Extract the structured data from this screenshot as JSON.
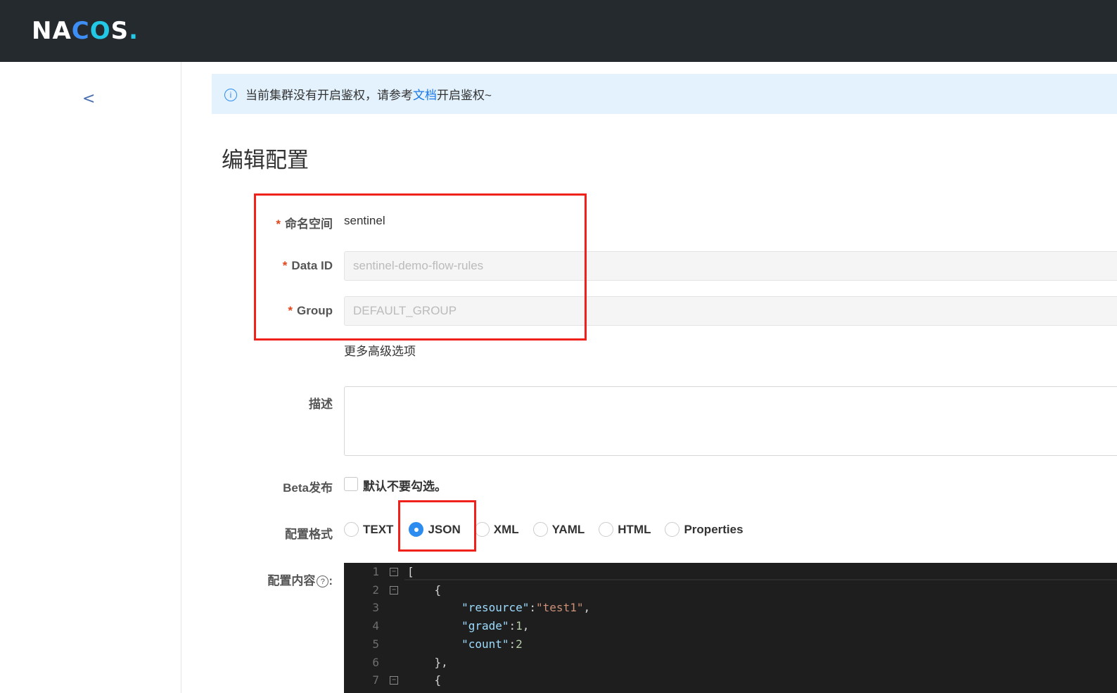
{
  "header": {
    "logo": "NACOS."
  },
  "notice": {
    "text_before": "当前集群没有开启鉴权，请参考",
    "link": "文档",
    "text_after": "开启鉴权~"
  },
  "page_title": "编辑配置",
  "form": {
    "namespace_label": "命名空间",
    "namespace_value": "sentinel",
    "dataid_label": "Data ID",
    "dataid_value": "sentinel-demo-flow-rules",
    "group_label": "Group",
    "group_value": "DEFAULT_GROUP",
    "advanced_link": "更多高级选项",
    "desc_label": "描述",
    "beta_label": "Beta发布",
    "beta_text": "默认不要勾选。",
    "format_label": "配置格式",
    "formats": [
      "TEXT",
      "JSON",
      "XML",
      "YAML",
      "HTML",
      "Properties"
    ],
    "selected_format": "JSON",
    "content_label": "配置内容",
    "help_glyph": "?",
    "colon": ":"
  },
  "editor": {
    "lines": [
      {
        "n": "1",
        "tokens": [
          [
            "p",
            "["
          ]
        ]
      },
      {
        "n": "2",
        "tokens": [
          [
            "p",
            "    {"
          ]
        ]
      },
      {
        "n": "3",
        "tokens": [
          [
            "p",
            "        "
          ],
          [
            "k",
            "\"resource\""
          ],
          [
            "p",
            ":"
          ],
          [
            "s",
            "\"test1\""
          ],
          [
            "p",
            ","
          ]
        ]
      },
      {
        "n": "4",
        "tokens": [
          [
            "p",
            "        "
          ],
          [
            "k",
            "\"grade\""
          ],
          [
            "p",
            ":"
          ],
          [
            "n",
            "1"
          ],
          [
            "p",
            ","
          ]
        ]
      },
      {
        "n": "5",
        "tokens": [
          [
            "p",
            "        "
          ],
          [
            "k",
            "\"count\""
          ],
          [
            "p",
            ":"
          ],
          [
            "n",
            "2"
          ]
        ]
      },
      {
        "n": "6",
        "tokens": [
          [
            "p",
            "    },"
          ]
        ]
      },
      {
        "n": "7",
        "tokens": [
          [
            "p",
            "    {"
          ]
        ]
      }
    ],
    "foldable": [
      "1",
      "2",
      "7"
    ]
  }
}
